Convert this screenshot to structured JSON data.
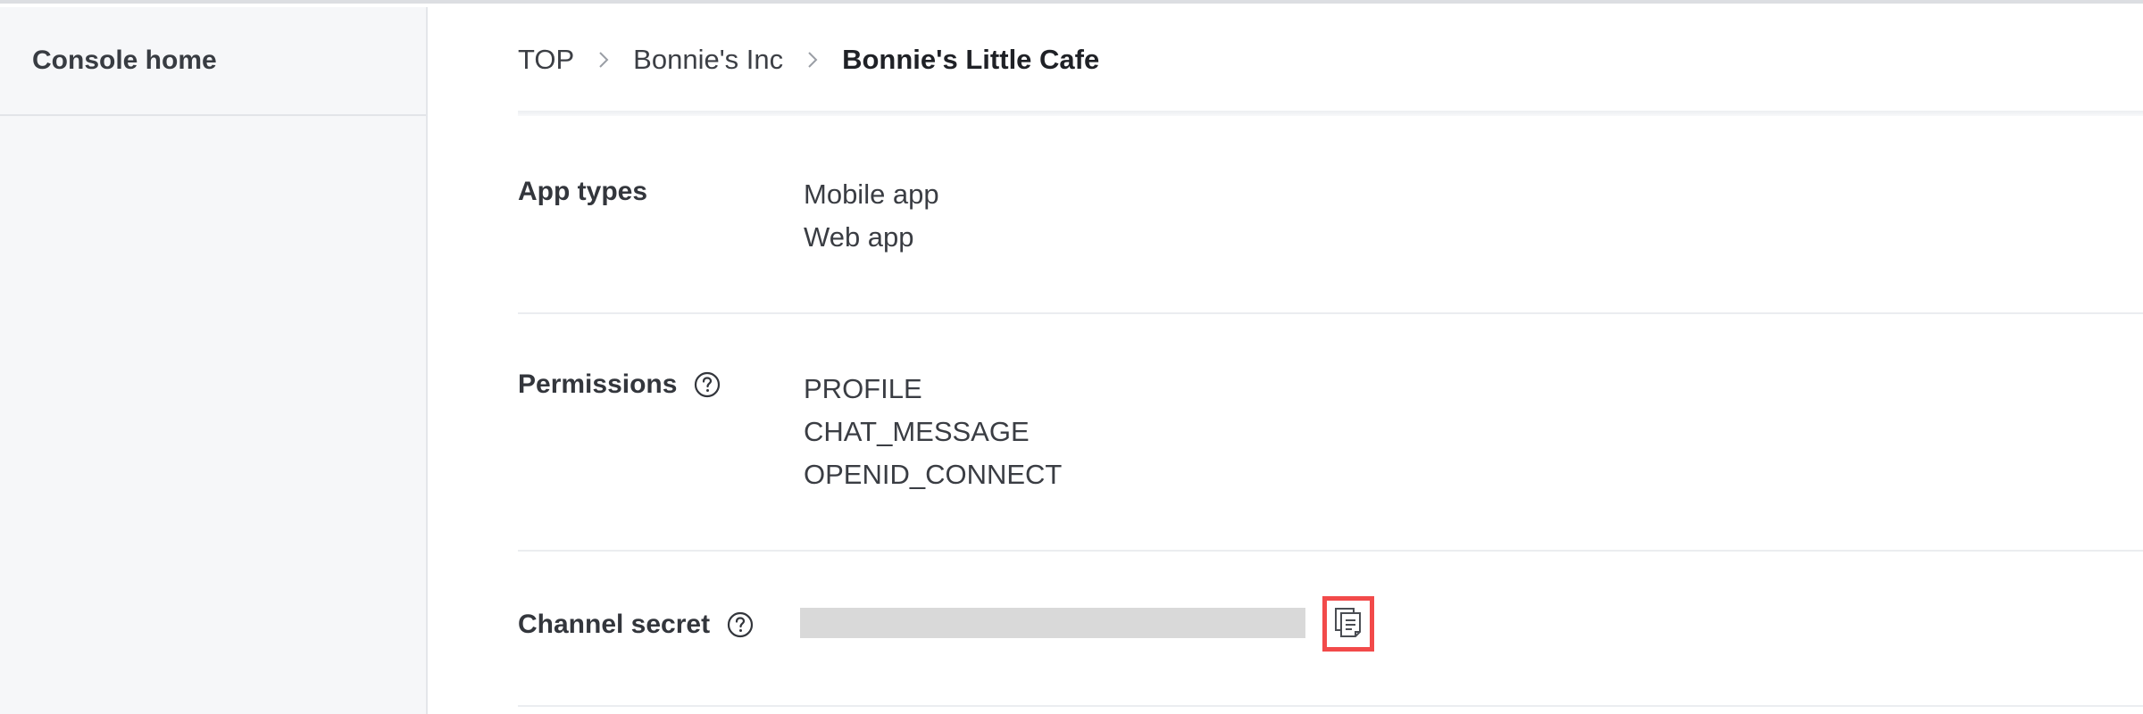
{
  "sidebar": {
    "home_label": "Console home"
  },
  "breadcrumb": {
    "items": [
      "TOP",
      "Bonnie's Inc",
      "Bonnie's Little Cafe"
    ]
  },
  "settings": {
    "app_types": {
      "label": "App types",
      "values": [
        "Mobile app",
        "Web app"
      ]
    },
    "permissions": {
      "label": "Permissions",
      "values": [
        "PROFILE",
        "CHAT_MESSAGE",
        "OPENID_CONNECT"
      ]
    },
    "channel_secret": {
      "label": "Channel secret",
      "value_masked": true
    }
  },
  "icons": {
    "breadcrumb_separator": "chevron-right-icon",
    "help": "question-circle-icon",
    "copy": "copy-icon"
  },
  "colors": {
    "highlight": "#f24a4a",
    "sidebar_bg": "#f6f7f9",
    "mask": "#d9d9d9"
  }
}
